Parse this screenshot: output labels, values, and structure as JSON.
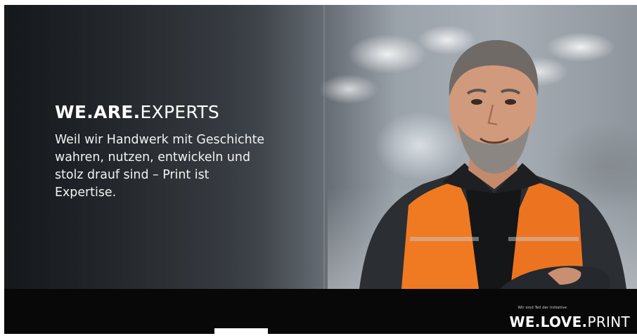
{
  "headline": {
    "bold": "WE.ARE.",
    "regular": "EXPERTS"
  },
  "body_text": "Weil wir Handwerk mit Geschichte wahren, nutzen, entwickeln und stolz drauf sind – Print ist Expertise.",
  "footer": {
    "initiative_note": "Wir sind Teil der Initiative",
    "logo_bold": "WE.LOVE.",
    "logo_regular": "PRINT"
  },
  "colors": {
    "vest_orange": "#f07a22",
    "jacket_dark": "#2a2d31",
    "bar_black": "#080808"
  }
}
